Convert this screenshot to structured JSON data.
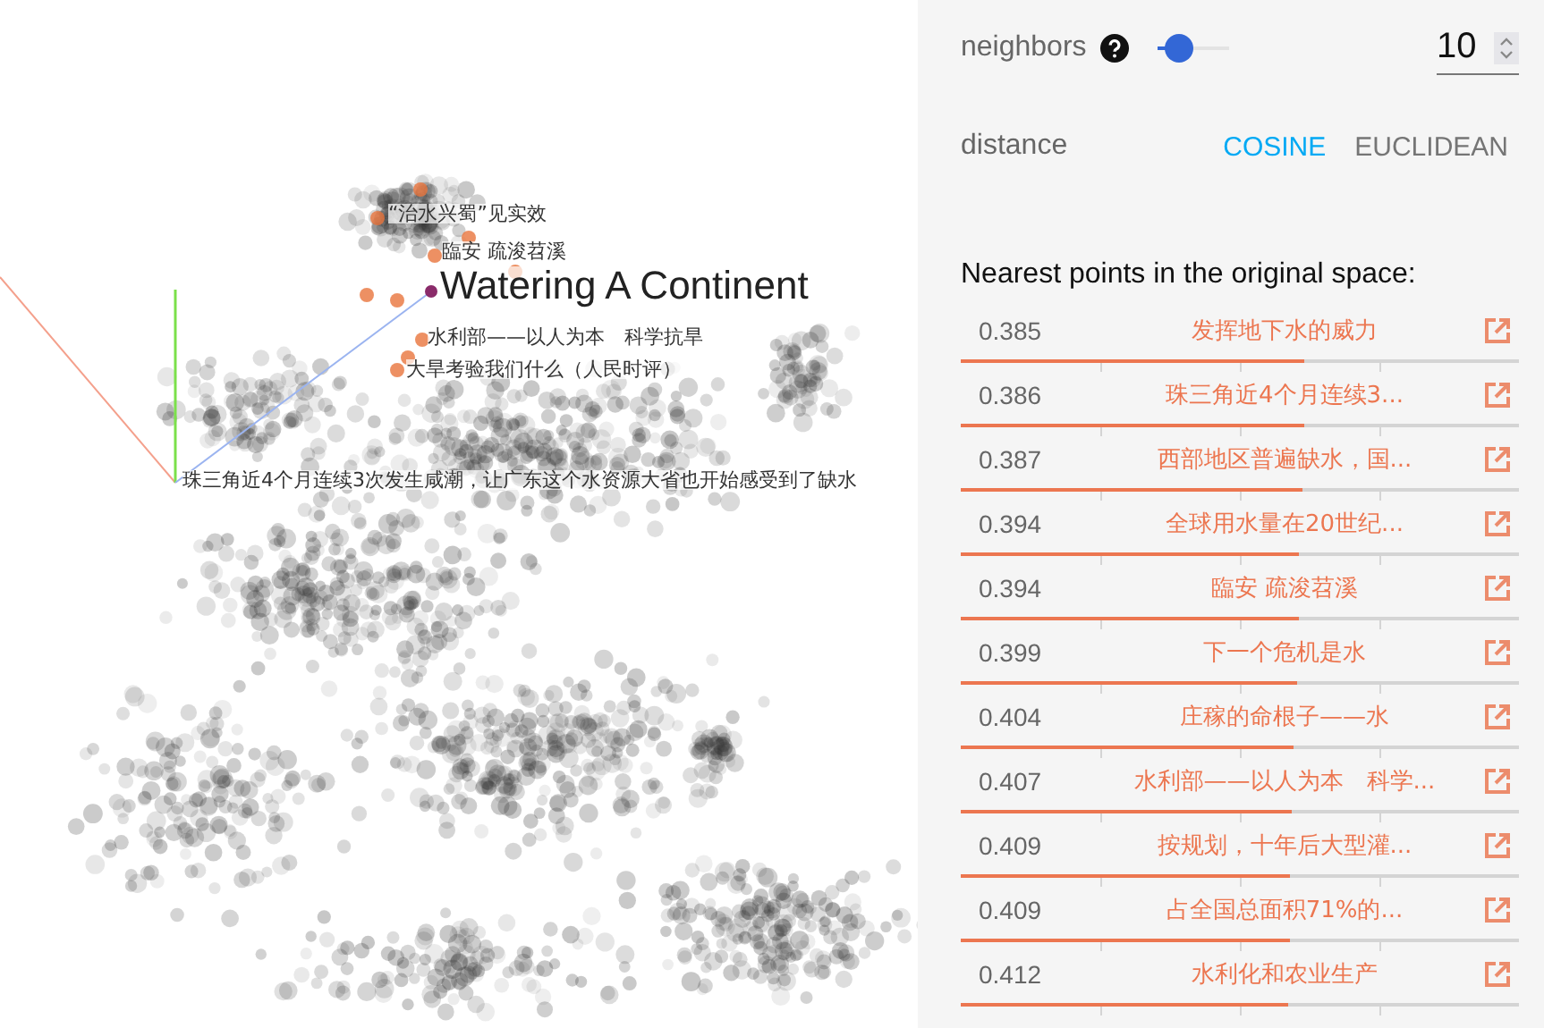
{
  "canvas": {
    "labels": [
      {
        "text": "“治水兴蜀”见实效",
        "kind": "neighbor"
      },
      {
        "text": "臨安 疏浚苕溪",
        "kind": "neighbor"
      },
      {
        "text": "Watering A Continent",
        "kind": "selected"
      },
      {
        "text": "水利部——以人为本　科学抗旱",
        "kind": "neighbor"
      },
      {
        "text": "大旱考验我们什么（人民时评）",
        "kind": "neighbor"
      },
      {
        "text": "珠三角近4个月连续3次发生咸潮，让广东这个水资源大省也开始感受到了缺水",
        "kind": "neighbor"
      }
    ]
  },
  "panel": {
    "neighbors": {
      "label": "neighbors",
      "level": 0.25,
      "value": "10"
    },
    "distance": {
      "label": "distance",
      "options": [
        {
          "label": "COSINE",
          "selected": true
        },
        {
          "label": "EUCLIDEAN",
          "selected": false
        }
      ]
    },
    "heading": "Nearest points in the original space:",
    "points": [
      {
        "distance": "0.385",
        "title": "发挥地下水的威力",
        "level": 0.615
      },
      {
        "distance": "0.386",
        "title": "珠三角近4个月连续3...",
        "level": 0.614
      },
      {
        "distance": "0.387",
        "title": "西部地区普遍缺水，国...",
        "level": 0.613
      },
      {
        "distance": "0.394",
        "title": "全球用水量在20世纪...",
        "level": 0.606
      },
      {
        "distance": "0.394",
        "title": "臨安 疏浚苕溪",
        "level": 0.606
      },
      {
        "distance": "0.399",
        "title": "下一个危机是水",
        "level": 0.601
      },
      {
        "distance": "0.404",
        "title": "庄稼的命根子——水",
        "level": 0.596
      },
      {
        "distance": "0.407",
        "title": "水利部——以人为本　科学...",
        "level": 0.593
      },
      {
        "distance": "0.409",
        "title": "按规划，十年后大型灌...",
        "level": 0.591
      },
      {
        "distance": "0.409",
        "title": "占全国总面积71%的...",
        "level": 0.591
      },
      {
        "distance": "0.412",
        "title": "水利化和农业生产",
        "level": 0.588
      }
    ]
  }
}
